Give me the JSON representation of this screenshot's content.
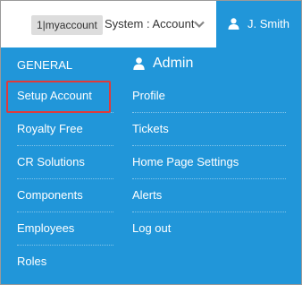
{
  "topbar": {
    "account_badge": "1|myaccount",
    "system_label": "System : Account",
    "user_name": "J. Smith",
    "system_chevron_icon": "chevron-down-icon",
    "user_icon": "user-icon"
  },
  "menu": {
    "general": {
      "heading": "GENERAL",
      "items": [
        {
          "label": "Setup Account",
          "highlighted": true
        },
        {
          "label": "Royalty Free"
        },
        {
          "label": "CR Solutions"
        },
        {
          "label": "Components"
        },
        {
          "label": "Employees"
        },
        {
          "label": "Roles"
        }
      ]
    },
    "admin": {
      "heading": "Admin",
      "icon": "user-icon",
      "items": [
        {
          "label": "Profile"
        },
        {
          "label": "Tickets"
        },
        {
          "label": "Home Page Settings"
        },
        {
          "label": "Alerts"
        },
        {
          "label": "Log out"
        }
      ]
    }
  },
  "colors": {
    "accent": "#2196d9",
    "highlight_border": "#e03a3a",
    "badge_bg": "#dddddd"
  }
}
